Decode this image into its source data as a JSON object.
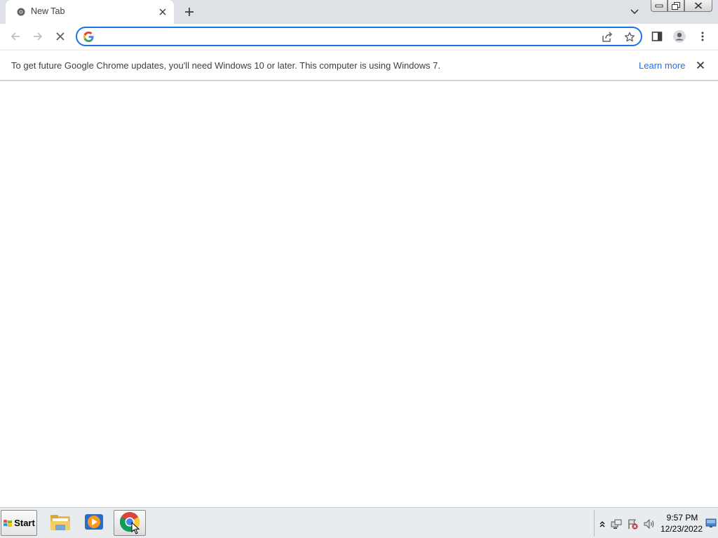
{
  "tabs": [
    {
      "title": "New Tab",
      "active": true
    }
  ],
  "omnibox": {
    "value": "",
    "placeholder": ""
  },
  "infobar": {
    "message": "To get future Google Chrome updates, you'll need Windows 10 or later. This computer is using Windows 7.",
    "link": "Learn more"
  },
  "taskbar": {
    "start_label": "Start",
    "apps": [
      {
        "name": "Windows Explorer",
        "icon": "folder-icon",
        "active": false
      },
      {
        "name": "Windows Media Player",
        "icon": "media-player-icon",
        "active": false
      },
      {
        "name": "Google Chrome",
        "icon": "chrome-icon",
        "active": true
      }
    ],
    "clock": {
      "time": "9:57 PM",
      "date": "12/23/2022"
    }
  },
  "colors": {
    "tabstrip": "#dee1e6",
    "accent": "#1a73e8",
    "taskbar": "#e9ecef"
  }
}
